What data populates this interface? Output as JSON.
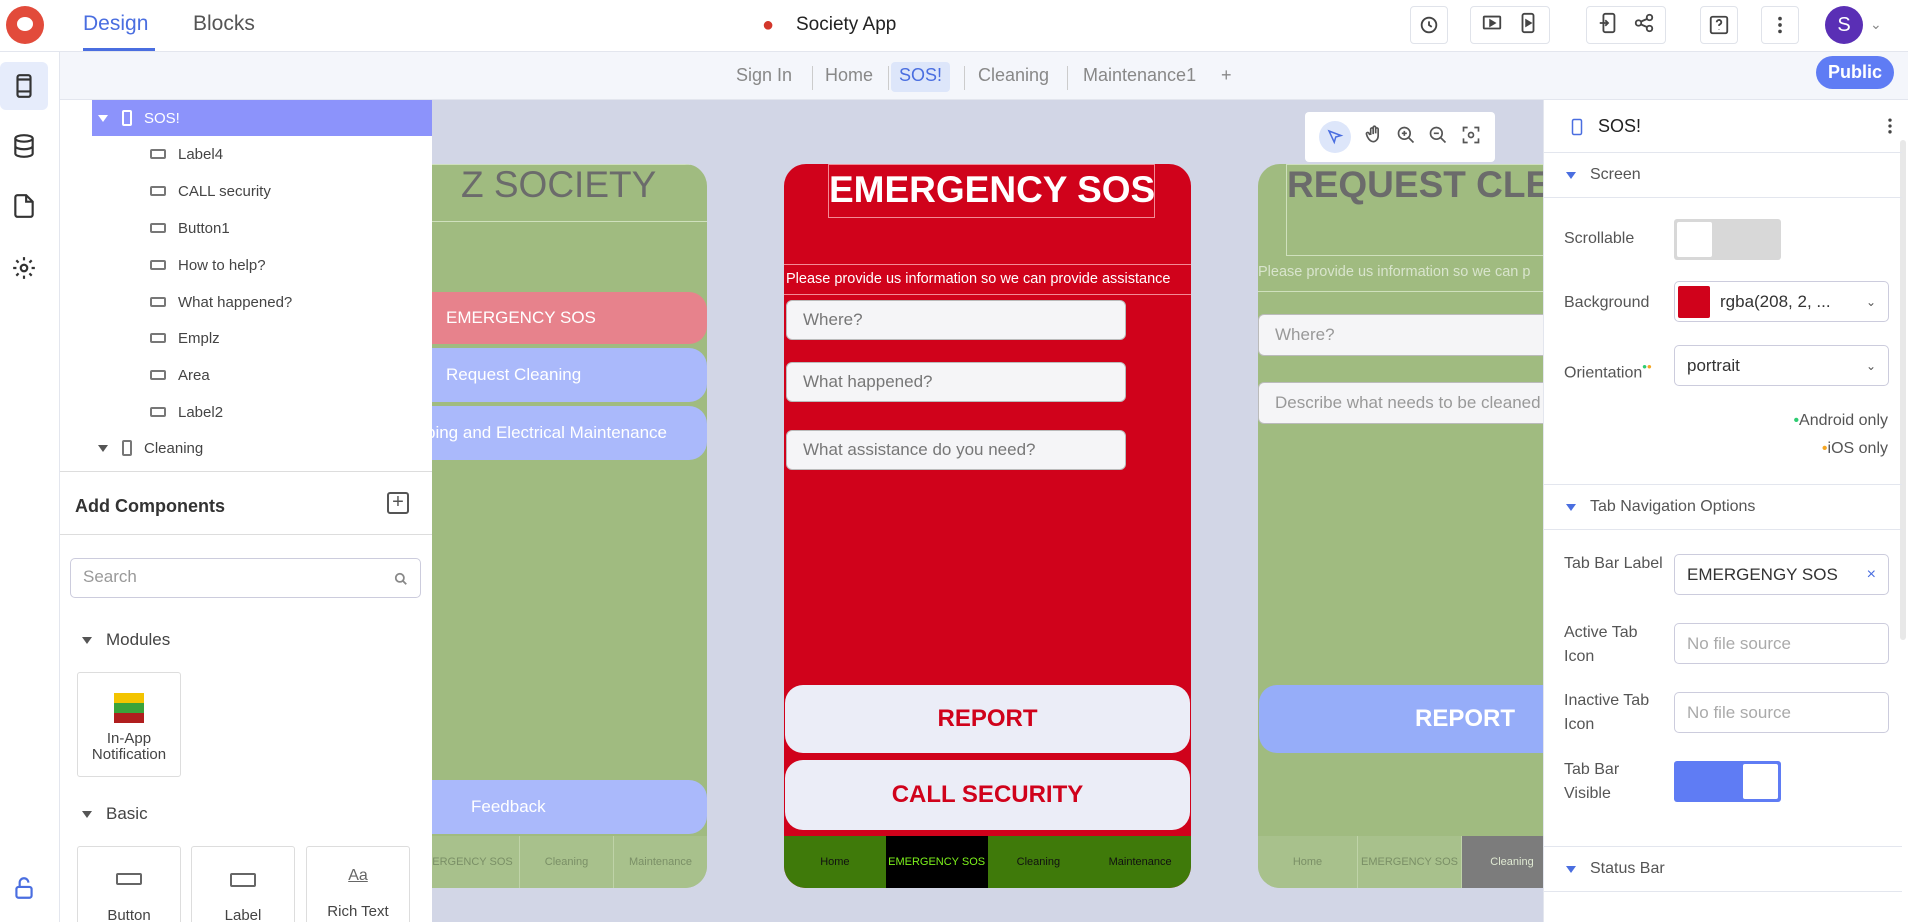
{
  "header": {
    "tabs": [
      {
        "label": "Design"
      },
      {
        "label": "Blocks"
      }
    ],
    "app_name": "Society App",
    "avatar_initial": "S"
  },
  "screen_tabs": {
    "items": [
      {
        "label": "Sign In"
      },
      {
        "label": "Home"
      },
      {
        "label": "SOS!"
      },
      {
        "label": "Cleaning"
      },
      {
        "label": "Maintenance1"
      }
    ],
    "add": "+",
    "public_label": "Public"
  },
  "tree": {
    "items": [
      {
        "label": "SOS!"
      },
      {
        "label": "Label4"
      },
      {
        "label": "CALL security"
      },
      {
        "label": "Button1"
      },
      {
        "label": "How to help?"
      },
      {
        "label": "What happened?"
      },
      {
        "label": "Emplz"
      },
      {
        "label": "Area"
      },
      {
        "label": "Label2"
      },
      {
        "label": "Cleaning"
      }
    ]
  },
  "add_components": {
    "title": "Add Components",
    "search_placeholder": "Search",
    "modules_label": "Modules",
    "module_item": "In-App Notification",
    "basic_label": "Basic",
    "basic_items": [
      {
        "label": "Button"
      },
      {
        "label": "Label"
      },
      {
        "label": "Rich Text"
      }
    ]
  },
  "phones": {
    "home": {
      "title": "Z SOCIETY",
      "buttons": [
        {
          "label": "EMERGENCY SOS"
        },
        {
          "label": "Request Cleaning"
        },
        {
          "label": "ping and Electrical Maintenance"
        }
      ],
      "feedback": "Feedback",
      "nav": [
        {
          "label": "ERGENCY SOS"
        },
        {
          "label": "Cleaning"
        },
        {
          "label": "Maintenance"
        }
      ]
    },
    "sos": {
      "title": "EMERGENCY SOS",
      "info": "Please provide us information so we can provide assistance",
      "inputs": [
        {
          "placeholder": "Where?"
        },
        {
          "placeholder": "What happened?"
        },
        {
          "placeholder": "What assistance do you need?"
        }
      ],
      "report": "REPORT",
      "call": "CALL SECURITY",
      "nav": [
        {
          "label": "Home"
        },
        {
          "label": "EMERGENCY SOS"
        },
        {
          "label": "Cleaning"
        },
        {
          "label": "Maintenance"
        }
      ]
    },
    "cleaning": {
      "title": "REQUEST CLEA",
      "info": "Please provide us information so we can p",
      "inputs": [
        {
          "placeholder": "Where?"
        },
        {
          "placeholder": "Describe what needs to be cleaned"
        }
      ],
      "report": "REPORT",
      "nav": [
        {
          "label": "Home"
        },
        {
          "label": "EMERGENCY SOS"
        },
        {
          "label": "Cleaning"
        }
      ]
    }
  },
  "properties": {
    "screen_name": "SOS!",
    "screen_section": "Screen",
    "scrollable_label": "Scrollable",
    "scrollable_on": false,
    "background_label": "Background",
    "background_value": "rgba(208, 2, ...",
    "background_color": "#d0021b",
    "orientation_label": "Orientation",
    "orientation_value": "portrait",
    "android_note": "Android only",
    "ios_note": "iOS only",
    "tab_section": "Tab Navigation Options",
    "tab_bar_label_label": "Tab Bar Label",
    "tab_bar_label_value": "EMERGENGY SOS",
    "active_icon_label": "Active Tab Icon",
    "inactive_icon_label": "Inactive Tab Icon",
    "no_file": "No file source",
    "tab_bar_visible_label": "Tab Bar Visible",
    "tab_bar_visible_on": true,
    "status_section": "Status Bar"
  },
  "colors": {
    "accent": "#4a6ee0",
    "sos_red": "#d0021b",
    "society_green": "#a0bb80",
    "nav_green": "#3f7a0a"
  }
}
